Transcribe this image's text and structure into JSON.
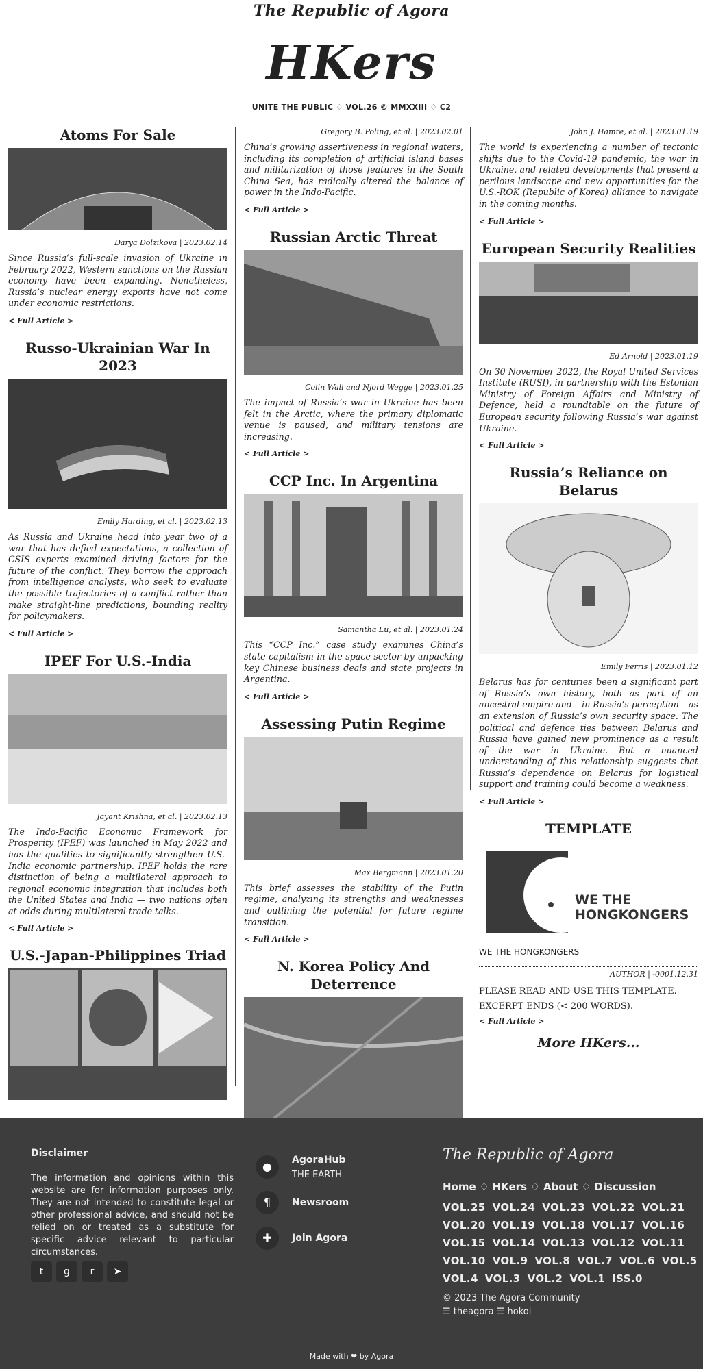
{
  "header": {
    "site_title": "The Republic of Agora",
    "masthead": "HKers",
    "tagline": "UNITE THE PUBLIC ♢ VOL.26 © MMXXIII ♢ C2"
  },
  "full_article_label": "< Full Article >",
  "col1": [
    {
      "title": "Atoms For Sale",
      "byline": "Darya Dolzikova | 2023.02.14",
      "excerpt": "Since Russia’s full-scale invasion of Ukraine in February 2022, Western sanctions on the Russian economy have been expanding. Nonetheless, Russia’s nuclear energy exports have not come under economic restrictions."
    },
    {
      "title": "Russo-Ukrainian War In 2023",
      "byline": "Emily Harding, et al. | 2023.02.13",
      "excerpt": "As Russia and Ukraine head into year two of a war that has defied expectations, a collection of CSIS experts examined driving factors for the future of the conflict. They borrow the approach from intelligence analysts, who seek to evaluate the possible trajectories of a conflict rather than make straight-line predictions, bounding reality for policymakers."
    },
    {
      "title": "IPEF For U.S.-India",
      "byline": "Jayant Krishna, et al. | 2023.02.13",
      "excerpt": "The Indo-Pacific Economic Framework for Prosperity (IPEF) was launched in May 2022 and has the qualities to significantly strengthen U.S.-India economic partnership. IPEF holds the rare distinction of being a multilateral approach to regional economic integration that includes both the United States and India — two nations often at odds during multilateral trade talks."
    },
    {
      "title": "U.S.-Japan-Philippines Triad"
    }
  ],
  "col2": [
    {
      "byline": "Gregory B. Poling, et al. | 2023.02.01",
      "excerpt": "China’s growing assertiveness in regional waters, including its completion of artificial island bases and militarization of those features in the South China Sea, has radically altered the balance of power in the Indo-Pacific."
    },
    {
      "title": "Russian Arctic Threat",
      "byline": "Colin Wall and Njord Wegge | 2023.01.25",
      "excerpt": "The impact of Russia’s war in Ukraine has been felt in the Arctic, where the primary diplomatic venue is paused, and military tensions are increasing."
    },
    {
      "title": "CCP Inc. In Argentina",
      "byline": "Samantha Lu, et al. | 2023.01.24",
      "excerpt": "This “CCP Inc.” case study examines China’s state capitalism in the space sector by unpacking key Chinese business deals and state projects in Argentina."
    },
    {
      "title": "Assessing Putin Regime",
      "byline": "Max Bergmann | 2023.01.20",
      "excerpt": "This brief assesses the stability of the Putin regime, analyzing its strengths and weaknesses and outlining the potential for future regime transition."
    },
    {
      "title": "N. Korea Policy And Deterrence"
    }
  ],
  "col3": [
    {
      "byline": "John J. Hamre, et al. | 2023.01.19",
      "excerpt": "The world is experiencing a number of tectonic shifts due to the Covid-19 pandemic, the war in Ukraine, and related developments that present a perilous landscape and new opportunities for the U.S.-ROK (Republic of Korea) alliance to navigate in the coming months."
    },
    {
      "title": "European Security Realities",
      "byline": "Ed Arnold | 2023.01.19",
      "excerpt": "On 30 November 2022, the Royal United Services Institute (RUSI), in partnership with the Estonian Ministry of Foreign Affairs and Ministry of Defence, held a roundtable on the future of European security following Russia’s war against Ukraine."
    },
    {
      "title": "Russia’s Reliance on Belarus",
      "byline": "Emily Ferris | 2023.01.12",
      "excerpt": "Belarus has for centuries been a significant part of Russia’s own history, both as part of an ancestral empire and – in Russia’s perception – as an extension of Russia’s own security space. The political and defence ties between Belarus and Russia have gained new prominence as a result of the war in Ukraine. But a nuanced understanding of this relationship suggests that Russia’s dependence on Belarus for logistical support and training could become a weakness."
    },
    {
      "title": "TEMPLATE",
      "logo_text": "WE THE HONGKONGERS",
      "caption": "WE THE HONGKONGERS",
      "byline": "AUTHOR | -0001.12.31",
      "excerpt1": "PLEASE READ AND USE THIS TEMPLATE.",
      "excerpt2": "EXCERPT ENDS (< 200 WORDS)."
    }
  ],
  "more_link": "More HKers...",
  "footer": {
    "disclaimer_title": "Disclaimer",
    "disclaimer_text": "The information and opinions within this website are for information purposes only. They are not intended to constitute legal or other professional advice, and should not be relied on or treated as a substitute for specific advice relevant to particular circumstances.",
    "links": [
      {
        "label": "AgoraHub",
        "sub": "THE EARTH",
        "icon": "map-pin-icon"
      },
      {
        "label": "Newsroom",
        "sub": "",
        "icon": "pilcrow-icon"
      },
      {
        "label": "Join Agora",
        "sub": "",
        "icon": "puzzle-icon"
      }
    ],
    "site_title": "The Republic of Agora",
    "nav": [
      "Home",
      "HKers",
      "About",
      "Discussion"
    ],
    "nav_sep": "♢",
    "volumes": [
      [
        "VOL.25",
        "VOL.24",
        "VOL.23",
        "VOL.22",
        "VOL.21"
      ],
      [
        "VOL.20",
        "VOL.19",
        "VOL.18",
        "VOL.17",
        "VOL.16"
      ],
      [
        "VOL.15",
        "VOL.14",
        "VOL.13",
        "VOL.12",
        "VOL.11"
      ],
      [
        "VOL.10",
        "VOL.9",
        "VOL.8",
        "VOL.7",
        "VOL.6",
        "VOL.5"
      ],
      [
        "VOL.4",
        "VOL.3",
        "VOL.2",
        "VOL.1",
        "ISS.0"
      ]
    ],
    "copyright": "© 2023 The Agora Community",
    "handles": "☰ theagora ☰ hokoi",
    "made_with": "Made with ❤ by Agora"
  }
}
